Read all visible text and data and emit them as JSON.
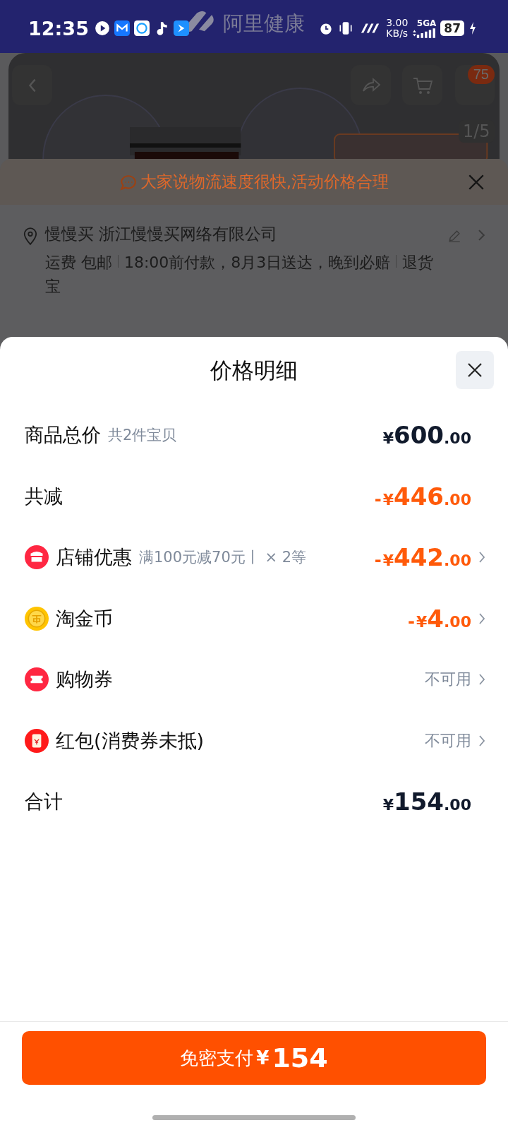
{
  "status_bar": {
    "time": "12:35",
    "speed_value": "3.00",
    "speed_unit": "KB/s",
    "network": "5GA",
    "battery": "87"
  },
  "header": {
    "store": "阿里健康"
  },
  "product": {
    "cart_badge": "75",
    "image_counter": "1/5"
  },
  "banner": {
    "text": "大家说物流速度很快,活动价格合理"
  },
  "address": {
    "name": "慢慢买 浙江慢慢买网络有限公司",
    "delivery": [
      "运费 包邮",
      "18:00前付款，8月3日送达，晚到必赔",
      "退货宝"
    ]
  },
  "sheet": {
    "title": "价格明细",
    "rows": [
      {
        "kind": "amount",
        "label": "商品总价",
        "note": "共2件宝贝",
        "sign": "",
        "currency": "¥",
        "main": "600",
        "cents": ".00",
        "highlight": false,
        "link": false
      },
      {
        "kind": "amount",
        "label": "共减",
        "note": "",
        "sign": "-",
        "currency": "¥",
        "main": "446",
        "cents": ".00",
        "highlight": true,
        "link": false
      },
      {
        "kind": "amount",
        "label": "店铺优惠",
        "note": "满100元减70元丨 × 2等",
        "sign": "-",
        "currency": "¥",
        "main": "442",
        "cents": ".00",
        "highlight": true,
        "link": true
      },
      {
        "kind": "amount",
        "label": "淘金币",
        "note": "",
        "sign": "-",
        "currency": "¥",
        "main": "4",
        "cents": ".00",
        "highlight": true,
        "link": true
      },
      {
        "kind": "status",
        "label": "购物券",
        "status": "不可用",
        "link": true
      },
      {
        "kind": "status",
        "label": "红包(消费券未抵)",
        "status": "不可用",
        "link": true
      },
      {
        "kind": "amount",
        "label": "合计",
        "note": "",
        "sign": "",
        "currency": "¥",
        "main": "154",
        "cents": ".00",
        "highlight": false,
        "link": false
      }
    ]
  },
  "pay_button": {
    "label": "免密支付",
    "currency": "¥",
    "amount": "154"
  }
}
